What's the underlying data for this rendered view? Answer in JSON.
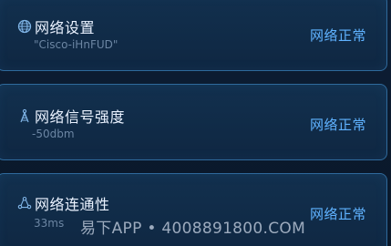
{
  "cards": [
    {
      "icon": "globe-icon",
      "title": "网络设置",
      "subtitle": "\"Cisco-iHnFUD\"",
      "status": "网络正常"
    },
    {
      "icon": "signal-tower-icon",
      "title": "网络信号强度",
      "subtitle": "-50dbm",
      "status": "网络正常"
    },
    {
      "icon": "connectivity-icon",
      "title": "网络连通性",
      "subtitle": "33ms",
      "status": "网络正常"
    }
  ],
  "watermark": "易下APP • 4008891800.COM",
  "colors": {
    "background": "#0c1c33",
    "card_border": "#2f6a9c",
    "title": "#eaf2ff",
    "subtitle": "#6c86a3",
    "status": "#5fb2ff",
    "icon": "#7fb4e6"
  }
}
